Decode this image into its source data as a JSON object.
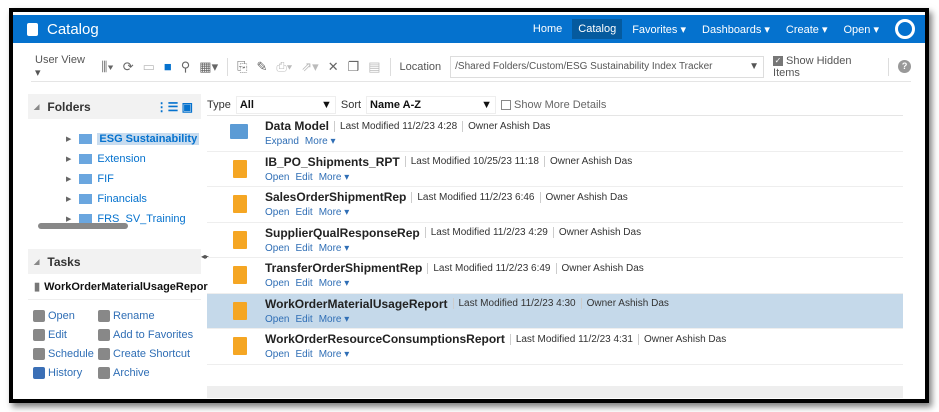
{
  "header": {
    "title": "Catalog",
    "nav": [
      {
        "label": "Home"
      },
      {
        "label": "Catalog",
        "active": true
      },
      {
        "label": "Favorites ▾"
      },
      {
        "label": "Dashboards ▾"
      },
      {
        "label": "Create ▾"
      },
      {
        "label": "Open ▾"
      }
    ]
  },
  "toolbar": {
    "view": "User View ▾",
    "location_label": "Location",
    "location_value": "/Shared Folders/Custom/ESG Sustainability Index Tracker",
    "show_hidden": "Show Hidden Items",
    "show_hidden_checked": true
  },
  "folders": {
    "title": "Folders",
    "items": [
      "ESG Sustainability",
      "Extension",
      "FIF",
      "Financials",
      "FRS_SV_Training"
    ]
  },
  "tasks": {
    "title": "Tasks",
    "selected": "WorkOrderMaterialUsageRepor",
    "actions": [
      "Open",
      "Rename",
      "Edit",
      "Add to Favorites",
      "Schedule",
      "Create Shortcut",
      "History",
      "Archive"
    ]
  },
  "filter": {
    "type_label": "Type",
    "type_value": "All",
    "sort_label": "Sort",
    "sort_value": "Name A-Z",
    "more_details": "Show More Details"
  },
  "items": [
    {
      "name": "Data Model",
      "modified": "Last Modified 11/2/23 4:28",
      "owner": "Owner Ashish Das",
      "kind": "folder",
      "actions": [
        "Expand",
        "More ▾"
      ]
    },
    {
      "name": "IB_PO_Shipments_RPT",
      "modified": "Last Modified 10/25/23 11:18",
      "owner": "Owner Ashish Das",
      "kind": "report",
      "actions": [
        "Open",
        "Edit",
        "More ▾"
      ]
    },
    {
      "name": "SalesOrderShipmentRep",
      "modified": "Last Modified 11/2/23 6:46",
      "owner": "Owner Ashish Das",
      "kind": "report",
      "actions": [
        "Open",
        "Edit",
        "More ▾"
      ]
    },
    {
      "name": "SupplierQualResponseRep",
      "modified": "Last Modified 11/2/23 4:29",
      "owner": "Owner Ashish Das",
      "kind": "report",
      "actions": [
        "Open",
        "Edit",
        "More ▾"
      ]
    },
    {
      "name": "TransferOrderShipmentRep",
      "modified": "Last Modified 11/2/23 6:49",
      "owner": "Owner Ashish Das",
      "kind": "report",
      "actions": [
        "Open",
        "Edit",
        "More ▾"
      ]
    },
    {
      "name": "WorkOrderMaterialUsageReport",
      "modified": "Last Modified 11/2/23 4:30",
      "owner": "Owner Ashish Das",
      "kind": "report",
      "selected": true,
      "actions": [
        "Open",
        "Edit",
        "More ▾"
      ]
    },
    {
      "name": "WorkOrderResourceConsumptionsReport",
      "modified": "Last Modified 11/2/23 4:31",
      "owner": "Owner Ashish Das",
      "kind": "report",
      "actions": [
        "Open",
        "Edit",
        "More ▾"
      ]
    }
  ]
}
